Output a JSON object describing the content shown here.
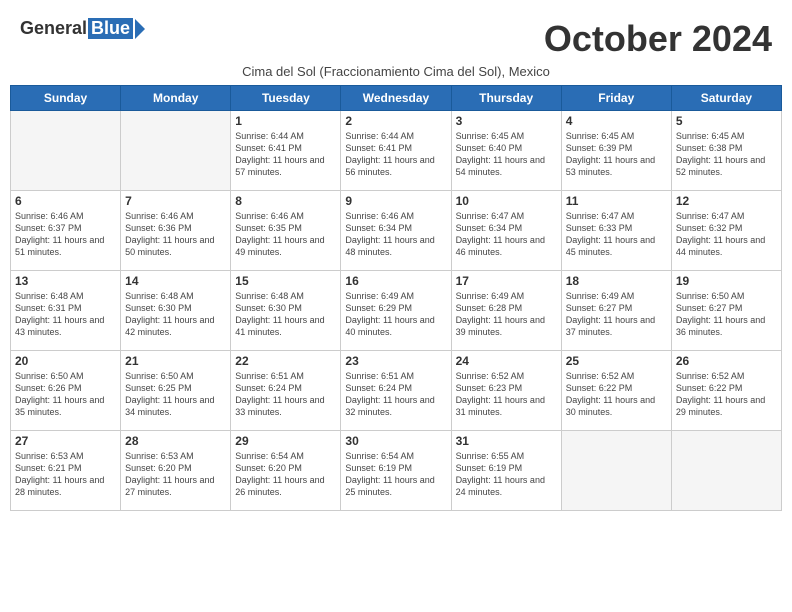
{
  "header": {
    "logo_general": "General",
    "logo_blue": "Blue",
    "month_title": "October 2024",
    "subtitle": "Cima del Sol (Fraccionamiento Cima del Sol), Mexico"
  },
  "weekdays": [
    "Sunday",
    "Monday",
    "Tuesday",
    "Wednesday",
    "Thursday",
    "Friday",
    "Saturday"
  ],
  "weeks": [
    [
      {
        "day": "",
        "info": ""
      },
      {
        "day": "",
        "info": ""
      },
      {
        "day": "1",
        "info": "Sunrise: 6:44 AM\nSunset: 6:41 PM\nDaylight: 11 hours and 57 minutes."
      },
      {
        "day": "2",
        "info": "Sunrise: 6:44 AM\nSunset: 6:41 PM\nDaylight: 11 hours and 56 minutes."
      },
      {
        "day": "3",
        "info": "Sunrise: 6:45 AM\nSunset: 6:40 PM\nDaylight: 11 hours and 54 minutes."
      },
      {
        "day": "4",
        "info": "Sunrise: 6:45 AM\nSunset: 6:39 PM\nDaylight: 11 hours and 53 minutes."
      },
      {
        "day": "5",
        "info": "Sunrise: 6:45 AM\nSunset: 6:38 PM\nDaylight: 11 hours and 52 minutes."
      }
    ],
    [
      {
        "day": "6",
        "info": "Sunrise: 6:46 AM\nSunset: 6:37 PM\nDaylight: 11 hours and 51 minutes."
      },
      {
        "day": "7",
        "info": "Sunrise: 6:46 AM\nSunset: 6:36 PM\nDaylight: 11 hours and 50 minutes."
      },
      {
        "day": "8",
        "info": "Sunrise: 6:46 AM\nSunset: 6:35 PM\nDaylight: 11 hours and 49 minutes."
      },
      {
        "day": "9",
        "info": "Sunrise: 6:46 AM\nSunset: 6:34 PM\nDaylight: 11 hours and 48 minutes."
      },
      {
        "day": "10",
        "info": "Sunrise: 6:47 AM\nSunset: 6:34 PM\nDaylight: 11 hours and 46 minutes."
      },
      {
        "day": "11",
        "info": "Sunrise: 6:47 AM\nSunset: 6:33 PM\nDaylight: 11 hours and 45 minutes."
      },
      {
        "day": "12",
        "info": "Sunrise: 6:47 AM\nSunset: 6:32 PM\nDaylight: 11 hours and 44 minutes."
      }
    ],
    [
      {
        "day": "13",
        "info": "Sunrise: 6:48 AM\nSunset: 6:31 PM\nDaylight: 11 hours and 43 minutes."
      },
      {
        "day": "14",
        "info": "Sunrise: 6:48 AM\nSunset: 6:30 PM\nDaylight: 11 hours and 42 minutes."
      },
      {
        "day": "15",
        "info": "Sunrise: 6:48 AM\nSunset: 6:30 PM\nDaylight: 11 hours and 41 minutes."
      },
      {
        "day": "16",
        "info": "Sunrise: 6:49 AM\nSunset: 6:29 PM\nDaylight: 11 hours and 40 minutes."
      },
      {
        "day": "17",
        "info": "Sunrise: 6:49 AM\nSunset: 6:28 PM\nDaylight: 11 hours and 39 minutes."
      },
      {
        "day": "18",
        "info": "Sunrise: 6:49 AM\nSunset: 6:27 PM\nDaylight: 11 hours and 37 minutes."
      },
      {
        "day": "19",
        "info": "Sunrise: 6:50 AM\nSunset: 6:27 PM\nDaylight: 11 hours and 36 minutes."
      }
    ],
    [
      {
        "day": "20",
        "info": "Sunrise: 6:50 AM\nSunset: 6:26 PM\nDaylight: 11 hours and 35 minutes."
      },
      {
        "day": "21",
        "info": "Sunrise: 6:50 AM\nSunset: 6:25 PM\nDaylight: 11 hours and 34 minutes."
      },
      {
        "day": "22",
        "info": "Sunrise: 6:51 AM\nSunset: 6:24 PM\nDaylight: 11 hours and 33 minutes."
      },
      {
        "day": "23",
        "info": "Sunrise: 6:51 AM\nSunset: 6:24 PM\nDaylight: 11 hours and 32 minutes."
      },
      {
        "day": "24",
        "info": "Sunrise: 6:52 AM\nSunset: 6:23 PM\nDaylight: 11 hours and 31 minutes."
      },
      {
        "day": "25",
        "info": "Sunrise: 6:52 AM\nSunset: 6:22 PM\nDaylight: 11 hours and 30 minutes."
      },
      {
        "day": "26",
        "info": "Sunrise: 6:52 AM\nSunset: 6:22 PM\nDaylight: 11 hours and 29 minutes."
      }
    ],
    [
      {
        "day": "27",
        "info": "Sunrise: 6:53 AM\nSunset: 6:21 PM\nDaylight: 11 hours and 28 minutes."
      },
      {
        "day": "28",
        "info": "Sunrise: 6:53 AM\nSunset: 6:20 PM\nDaylight: 11 hours and 27 minutes."
      },
      {
        "day": "29",
        "info": "Sunrise: 6:54 AM\nSunset: 6:20 PM\nDaylight: 11 hours and 26 minutes."
      },
      {
        "day": "30",
        "info": "Sunrise: 6:54 AM\nSunset: 6:19 PM\nDaylight: 11 hours and 25 minutes."
      },
      {
        "day": "31",
        "info": "Sunrise: 6:55 AM\nSunset: 6:19 PM\nDaylight: 11 hours and 24 minutes."
      },
      {
        "day": "",
        "info": ""
      },
      {
        "day": "",
        "info": ""
      }
    ]
  ]
}
